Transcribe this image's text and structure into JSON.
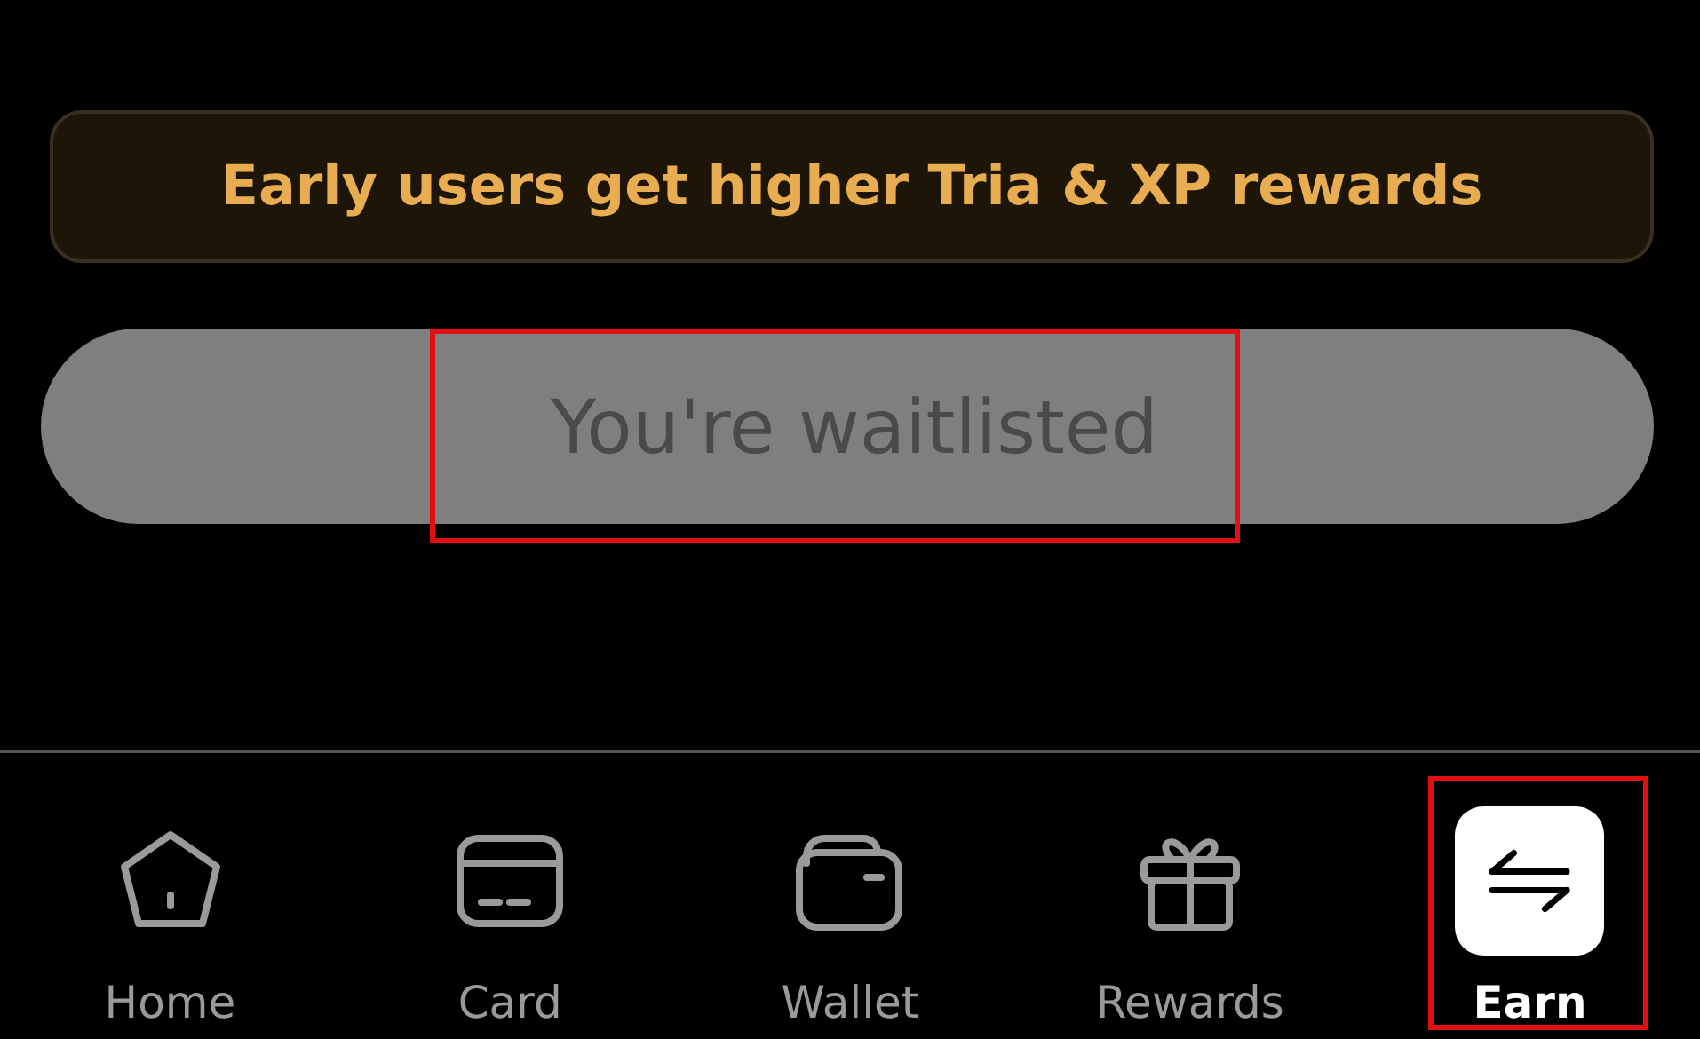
{
  "banner": {
    "text": "Early users get higher Tria & XP rewards"
  },
  "status_button": {
    "label": "You're waitlisted",
    "disabled": true,
    "highlighted": true
  },
  "nav": [
    {
      "label": "Home",
      "kind": "home",
      "selected": false,
      "highlighted": false
    },
    {
      "label": "Card",
      "kind": "card",
      "selected": false,
      "highlighted": false
    },
    {
      "label": "Wallet",
      "kind": "wallet",
      "selected": false,
      "highlighted": false
    },
    {
      "label": "Rewards",
      "kind": "gift",
      "selected": false,
      "highlighted": false
    },
    {
      "label": "Earn",
      "kind": "swap",
      "selected": true,
      "highlighted": true
    }
  ]
}
